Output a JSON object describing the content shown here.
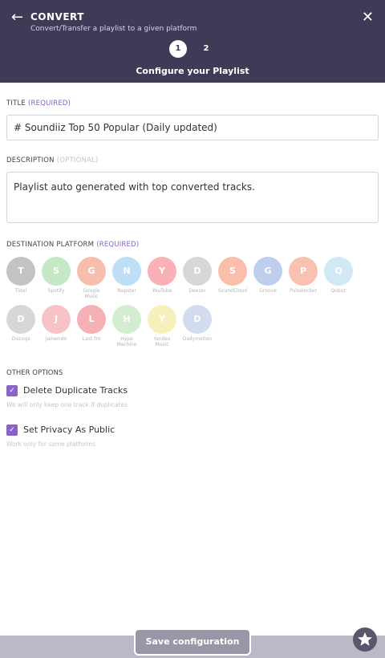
{
  "header": {
    "title": "CONVERT",
    "subtitle": "Convert/Transfer a playlist to a given platform",
    "step1": "1",
    "step2": "2",
    "step_title": "Configure your Playlist"
  },
  "form": {
    "title_label": "TITLE",
    "title_required": "(REQUIRED)",
    "title_value": "# Soundiiz Top 50 Popular (Daily updated)",
    "description_label": "DESCRIPTION",
    "description_optional": "(OPTIONAL)",
    "description_value": "Playlist auto generated with top converted tracks.",
    "destination_label": "DESTINATION PLATFORM",
    "destination_required": "(REQUIRED)"
  },
  "platforms": [
    {
      "letter": "T",
      "name": "Tidal",
      "color": "#bdbdbd"
    },
    {
      "letter": "S",
      "name": "Spotify",
      "color": "#bfe6bf"
    },
    {
      "letter": "G",
      "name": "Google Music",
      "color": "#f7b7a6"
    },
    {
      "letter": "N",
      "name": "Napster",
      "color": "#b7dcf5"
    },
    {
      "letter": "Y",
      "name": "YouTube",
      "color": "#f7a9b0"
    },
    {
      "letter": "D",
      "name": "Deezer",
      "color": "#d3d3d3"
    },
    {
      "letter": "S",
      "name": "SoundCloud",
      "color": "#f9b9a3"
    },
    {
      "letter": "G",
      "name": "Groove",
      "color": "#b8c9ec"
    },
    {
      "letter": "P",
      "name": "Pulselocker",
      "color": "#f8bba9"
    },
    {
      "letter": "Q",
      "name": "Qobuz",
      "color": "#cbe7f4"
    },
    {
      "letter": "D",
      "name": "Discogs",
      "color": "#d3d3d3"
    },
    {
      "letter": "J",
      "name": "Jamendo",
      "color": "#f7bcc3"
    },
    {
      "letter": "L",
      "name": "Last.fm",
      "color": "#f4a9ad"
    },
    {
      "letter": "H",
      "name": "Hype Machine",
      "color": "#cfeccb"
    },
    {
      "letter": "Y",
      "name": "Yandex Music",
      "color": "#f7efb4"
    },
    {
      "letter": "D",
      "name": "Dailymotion",
      "color": "#cfd9ee"
    }
  ],
  "options": {
    "label": "OTHER OPTIONS",
    "delete_dupes": "Delete Duplicate Tracks",
    "delete_dupes_hint": "We will only keep one track if duplicates",
    "privacy": "Set Privacy As Public",
    "privacy_hint": "Work only for some platforms"
  },
  "footer": {
    "save_label": "Save configuration"
  },
  "icons": {
    "back": "←",
    "close": "✕",
    "check": "✓",
    "star": "★"
  }
}
